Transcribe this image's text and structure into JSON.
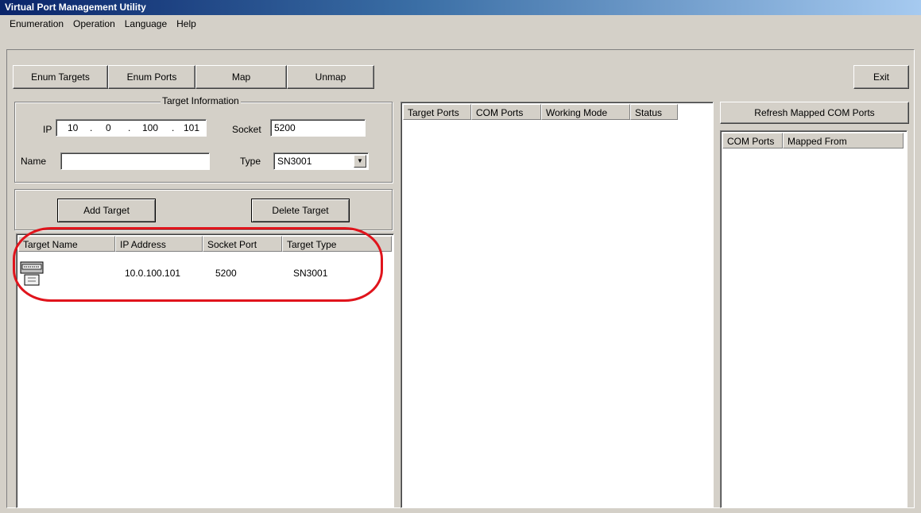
{
  "window": {
    "title": "Virtual Port Management Utility"
  },
  "menu": [
    "Enumeration",
    "Operation",
    "Language",
    "Help"
  ],
  "toolbar": {
    "enum_targets": "Enum Targets",
    "enum_ports": "Enum Ports",
    "map": "Map",
    "unmap": "Unmap",
    "exit": "Exit"
  },
  "target_info": {
    "title": "Target Information",
    "ip_label": "IP",
    "ip": [
      "10",
      "0",
      "100",
      "101"
    ],
    "socket_label": "Socket",
    "socket": "5200",
    "name_label": "Name",
    "name": "",
    "type_label": "Type",
    "type": "SN3001"
  },
  "actions": {
    "add_target": "Add Target",
    "delete_target": "Delete Target"
  },
  "targets_table": {
    "columns": [
      "Target Name",
      "IP Address",
      "Socket Port",
      "Target Type"
    ],
    "rows": [
      {
        "name": "",
        "icon": "device-icon",
        "ip": "10.0.100.101",
        "port": "5200",
        "type": "SN3001"
      }
    ]
  },
  "ports_table": {
    "columns": [
      "Target Ports",
      "COM Ports",
      "Working Mode",
      "Status"
    ]
  },
  "mapped": {
    "refresh_label": "Refresh Mapped COM Ports",
    "columns": [
      "COM Ports",
      "Mapped From"
    ]
  },
  "colors": {
    "highlight": "#e0141c",
    "title_gradient_start": "#0a246a"
  }
}
